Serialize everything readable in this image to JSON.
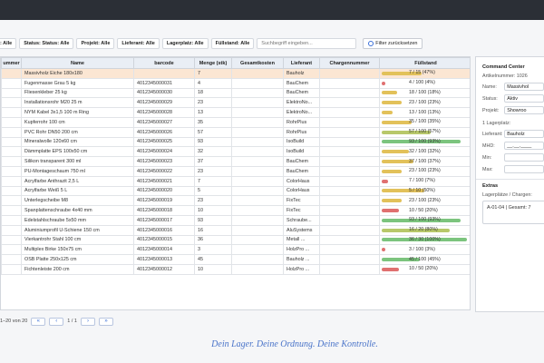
{
  "filters": {
    "chips": [
      ": Alle",
      "Status: Status: Alle",
      "Projekt: Alle",
      "Lieferant: Alle",
      "Lagerplatz: Alle",
      "Füllstand: Alle"
    ],
    "search_placeholder": "Suchbegriff eingeben...",
    "reset_label": "Filter zurücksetzen"
  },
  "table": {
    "headers": [
      "ummer",
      "Name",
      "barcode",
      "Menge (stk)",
      "Gesamtkosten",
      "Lieferant",
      "Chargennummer",
      "Füllstand"
    ],
    "rows": [
      {
        "name": "Massivholz Eiche 180x180",
        "barcode": "",
        "qty": "7",
        "supplier": "Bauholz",
        "fill": "7 / 15 (47%)",
        "level": 0.47,
        "color": "#e2c15a",
        "highlight": true
      },
      {
        "name": "Fugenmasse Grau 5 kg",
        "barcode": "4012345000031",
        "qty": "4",
        "supplier": "BauChem",
        "fill": "4 / 100 (4%)",
        "level": 0.04,
        "color": "#e07070",
        "highlight": false
      },
      {
        "name": "Fliesenkleber 25 kg",
        "barcode": "4012345000030",
        "qty": "18",
        "supplier": "BauChem",
        "fill": "18 / 100 (18%)",
        "level": 0.18,
        "color": "#e2c15a",
        "highlight": false
      },
      {
        "name": "Installationsrohr M20 25 m",
        "barcode": "4012345000029",
        "qty": "23",
        "supplier": "ElektroNo...",
        "fill": "23 / 100 (23%)",
        "level": 0.23,
        "color": "#e2c15a",
        "highlight": false
      },
      {
        "name": "NYM Kabel 3x1,5 100 m Ring",
        "barcode": "4012345000028",
        "qty": "13",
        "supplier": "ElektroNo...",
        "fill": "13 / 100 (13%)",
        "level": 0.13,
        "color": "#e2c15a",
        "highlight": false
      },
      {
        "name": "Kupferrohr 100 cm",
        "barcode": "4012345000027",
        "qty": "35",
        "supplier": "RohrPlus",
        "fill": "35 / 100 (35%)",
        "level": 0.35,
        "color": "#e2c15a",
        "highlight": false
      },
      {
        "name": "PVC Rohr DN50 200 cm",
        "barcode": "4012345000026",
        "qty": "57",
        "supplier": "RohrPlus",
        "fill": "57 / 100 (57%)",
        "level": 0.57,
        "color": "#b8c86a",
        "highlight": false
      },
      {
        "name": "Mineralwolle 120x60 cm",
        "barcode": "4012345000025",
        "qty": "93",
        "supplier": "IsoBuild",
        "fill": "93 / 100 (93%)",
        "level": 0.93,
        "color": "#7cc47e",
        "highlight": false
      },
      {
        "name": "Dämmplatte EPS 100x50 cm",
        "barcode": "4012345000024",
        "qty": "32",
        "supplier": "IsoBuild",
        "fill": "32 / 100 (32%)",
        "level": 0.32,
        "color": "#e2c15a",
        "highlight": false
      },
      {
        "name": "Silikon transparent 300 ml",
        "barcode": "4012345000023",
        "qty": "37",
        "supplier": "BauChem",
        "fill": "37 / 100 (37%)",
        "level": 0.37,
        "color": "#e2c15a",
        "highlight": false
      },
      {
        "name": "PU-Montageschaum 750 ml",
        "barcode": "4012345000022",
        "qty": "23",
        "supplier": "BauChem",
        "fill": "23 / 100 (23%)",
        "level": 0.23,
        "color": "#e2c15a",
        "highlight": false
      },
      {
        "name": "Acrylfarbe Anthrazit 2,5 L",
        "barcode": "4012345000021",
        "qty": "7",
        "supplier": "ColorHaus",
        "fill": "7 / 100 (7%)",
        "level": 0.07,
        "color": "#e07070",
        "highlight": false
      },
      {
        "name": "Acrylfarbe Weiß 5 L",
        "barcode": "4012345000020",
        "qty": "5",
        "supplier": "ColorHaus",
        "fill": "5 / 10 (50%)",
        "level": 0.5,
        "color": "#e2c15a",
        "highlight": false
      },
      {
        "name": "Unterlegscheibe M8",
        "barcode": "4012345000019",
        "qty": "23",
        "supplier": "FixTec",
        "fill": "23 / 100 (23%)",
        "level": 0.23,
        "color": "#e2c15a",
        "highlight": false
      },
      {
        "name": "Spanplattenschraube 4x40 mm",
        "barcode": "4012345000018",
        "qty": "10",
        "supplier": "FixTec",
        "fill": "10 / 50 (20%)",
        "level": 0.2,
        "color": "#e07070",
        "highlight": false
      },
      {
        "name": "Edelstahlschraube 5x50 mm",
        "barcode": "4012345000017",
        "qty": "93",
        "supplier": "Schraube...",
        "fill": "93 / 100 (93%)",
        "level": 0.93,
        "color": "#7cc47e",
        "highlight": false
      },
      {
        "name": "Aluminiumprofil U-Schiene 150 cm",
        "barcode": "4012345000016",
        "qty": "16",
        "supplier": "AluSystems",
        "fill": "16 / 20 (80%)",
        "level": 0.8,
        "color": "#b8c86a",
        "highlight": false
      },
      {
        "name": "Vierkantrohr Stahl 100 cm",
        "barcode": "4012345000015",
        "qty": "36",
        "supplier": "Metall ...",
        "fill": "36 / 30 (100%)",
        "level": 1.0,
        "color": "#7cc47e",
        "highlight": false
      },
      {
        "name": "Multiplex Birke 150x75 cm",
        "barcode": "4012345000014",
        "qty": "3",
        "supplier": "HolzPro ...",
        "fill": "3 / 100 (3%)",
        "level": 0.03,
        "color": "#e07070",
        "highlight": false
      },
      {
        "name": "OSB Platte 250x125 cm",
        "barcode": "4012345000013",
        "qty": "45",
        "supplier": "Bauholz ...",
        "fill": "45 / 100 (45%)",
        "level": 0.45,
        "color": "#7cc47e",
        "highlight": false
      },
      {
        "name": "Fichtenleiste 200 cm",
        "barcode": "4012345000012",
        "qty": "10",
        "supplier": "HolzPro ...",
        "fill": "10 / 50 (20%)",
        "level": 0.2,
        "color": "#e07070",
        "highlight": false
      }
    ]
  },
  "pager": {
    "range": "1–20 von 20",
    "first": "«",
    "prev": "‹",
    "page": "1 / 1",
    "next": "›",
    "last": "»"
  },
  "tagline": "Dein Lager. Deine Ordnung. Deine Kontrolle.",
  "panel": {
    "title": "Command Center",
    "artikel": "Artikelnummer:  1026",
    "fields": [
      {
        "key": "Name:",
        "value": "Massivhol"
      },
      {
        "key": "Status:",
        "value": "Aktiv"
      },
      {
        "key": "Projekt:",
        "value": "Showroo"
      }
    ],
    "lagerplatz": "1 Lagerplatz:",
    "lieferant_key": "Lieferant:",
    "lieferant_value": "Bauholz",
    "mhd_key": "MHD:",
    "mhd_value": "__.__.____",
    "min_key": "Min:",
    "max_key": "Max:",
    "extras": "Extras",
    "chargen_label": "Lagerplätze / Chargen:",
    "chargen_value": "A-01-04 | Gesamt: 7"
  }
}
